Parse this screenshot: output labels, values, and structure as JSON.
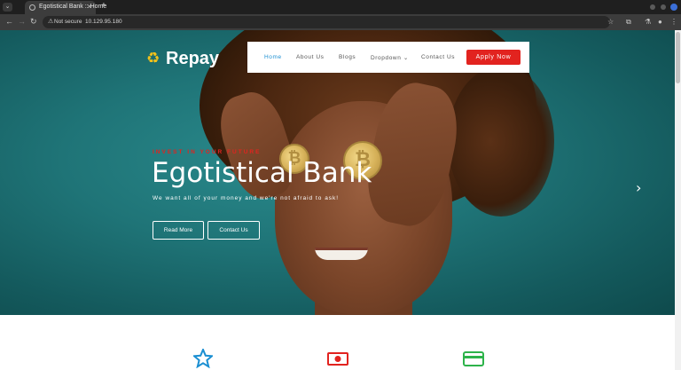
{
  "browser": {
    "tab_title": "Egotistical Bank :: Home",
    "tab_close": "×",
    "new_tab": "+",
    "security_label": "Not secure",
    "url": "10.129.95.180"
  },
  "site": {
    "logo_text": "Repay",
    "nav": {
      "items": [
        {
          "label": "Home",
          "active": true
        },
        {
          "label": "About Us"
        },
        {
          "label": "Blogs"
        },
        {
          "label": "Dropdown ⌄"
        },
        {
          "label": "Contact Us"
        }
      ],
      "apply_label": "Apply Now"
    },
    "hero": {
      "kicker": "INVEST IN YOUR FUTURE",
      "title": "Egotistical Bank",
      "tagline": "We want all of your money and we're not afraid to ask!",
      "read_more": "Read More",
      "contact": "Contact Us",
      "coin_symbol": "₿"
    },
    "services": {
      "icons": [
        "star-icon",
        "money-icon",
        "credit-card-icon"
      ]
    }
  },
  "colors": {
    "accent_red": "#e2231f",
    "accent_blue": "#1b8fd2",
    "hero_teal": "#1f7477",
    "logo_yellow": "#f4c21a"
  }
}
